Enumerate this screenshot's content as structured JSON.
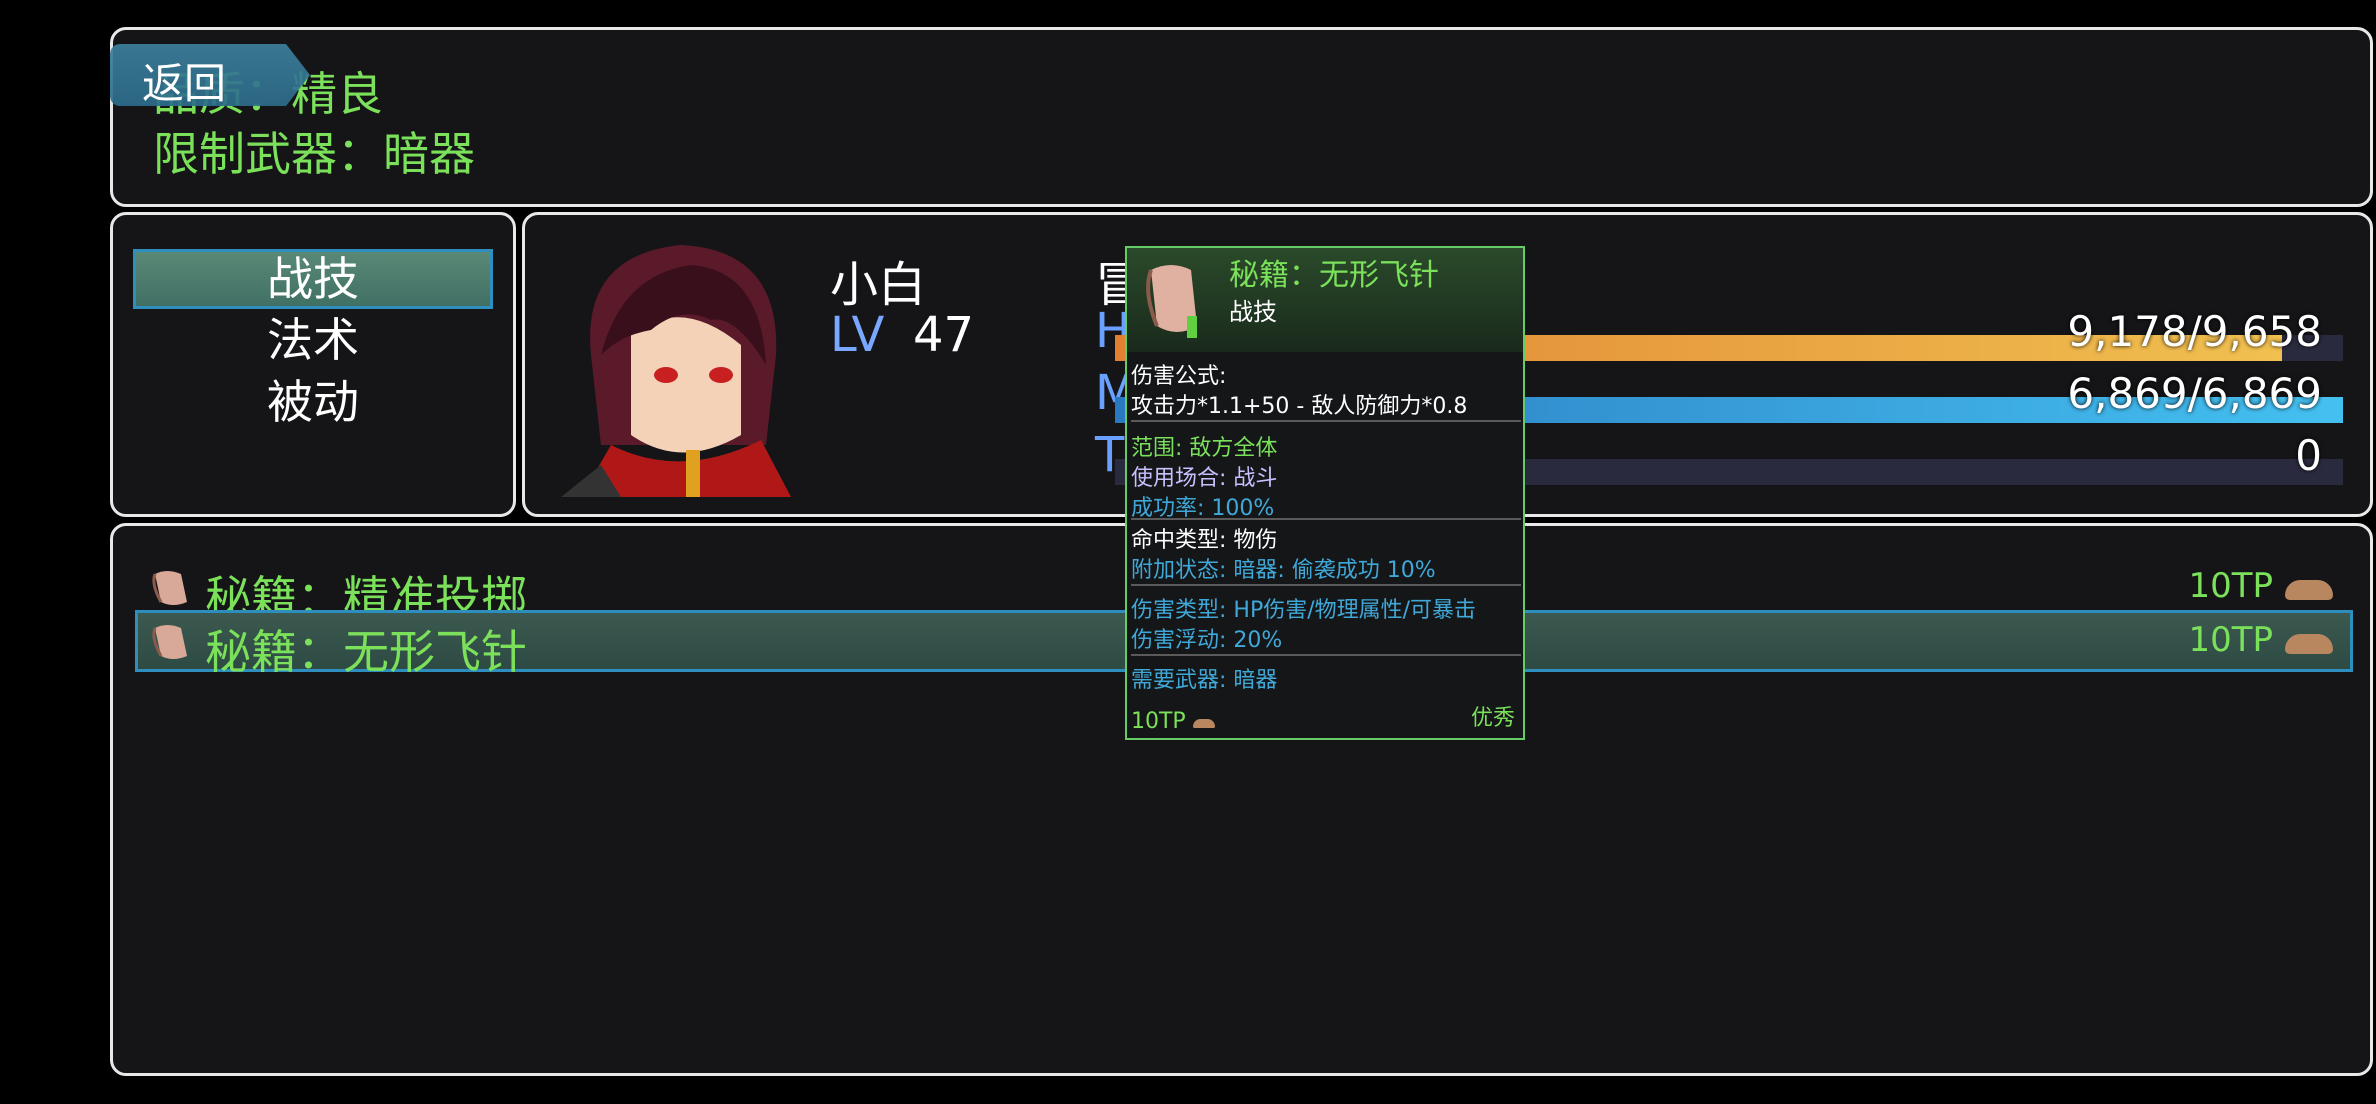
{
  "help": {
    "line1": "品质：精良",
    "line2": "限制武器：暗器",
    "back_label": "返回"
  },
  "skill_types": [
    "战技",
    "法术",
    "被动"
  ],
  "actor": {
    "name": "小白",
    "lv_label": "LV",
    "level": "47",
    "class": "冒",
    "hp_label": "H",
    "hp": "9,178/9,658",
    "hp_fraction": 0.95,
    "mp_label": "M",
    "mp": "6,869/6,869",
    "mp_fraction": 1.0,
    "tp_label": "T",
    "tp": "0",
    "tp_fraction": 0
  },
  "skills": [
    {
      "name": "秘籍：精准投掷",
      "cost": "10TP"
    },
    {
      "name": "秘籍：无形飞针",
      "cost": "10TP"
    }
  ],
  "tooltip": {
    "title": "秘籍：无形飞针",
    "type": "战技",
    "formula_label": "伤害公式:",
    "formula": "攻击力*1.1+50 - 敌人防御力*0.8",
    "scope": "范围: 敌方全体",
    "occasion": "使用场合:  战斗",
    "success": "成功率: 100%",
    "hit_type": "命中类型: 物伤",
    "add_state": "附加状态: 暗器: 偷袭成功 10%",
    "damage_type": "伤害类型: HP伤害/物理属性/可暴击",
    "variance": "伤害浮动: 20%",
    "weapon": "需要武器: 暗器",
    "cost": "10TP",
    "rarity": "优秀"
  },
  "colors": {
    "accent_green": "#7be05a",
    "hp_gauge": "#e8a040",
    "mp_gauge": "#3aa8e0",
    "cursor_blue": "#2e8fbf"
  }
}
